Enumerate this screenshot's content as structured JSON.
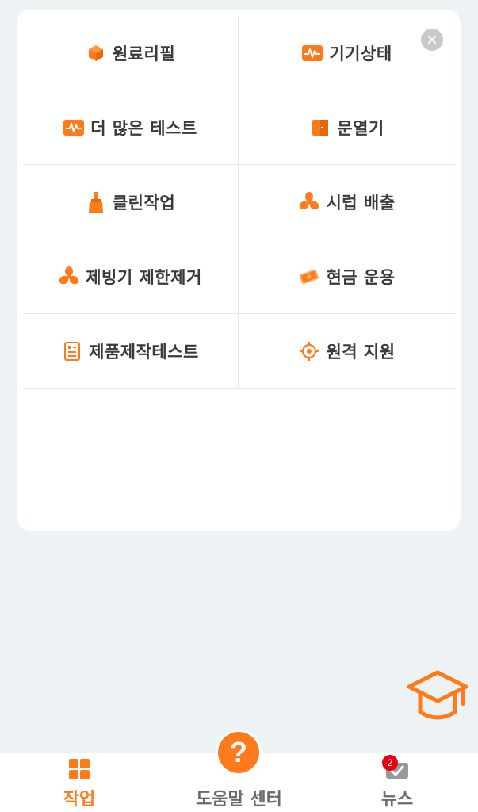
{
  "colors": {
    "accent": "#ff7a1a",
    "background": "#edf2f5",
    "text": "#3a3a3a",
    "badge": "#e60012"
  },
  "menu": {
    "items": [
      {
        "label": "원료리필",
        "icon": "box-icon"
      },
      {
        "label": "기기상태",
        "icon": "pulse-icon"
      },
      {
        "label": "더 많은 테스트",
        "icon": "pulse-icon"
      },
      {
        "label": "문열기",
        "icon": "door-icon"
      },
      {
        "label": "클린작업",
        "icon": "brush-icon"
      },
      {
        "label": "시럽 배출",
        "icon": "fan-icon"
      },
      {
        "label": "제빙기 제한제거",
        "icon": "fan-icon"
      },
      {
        "label": "현금 운용",
        "icon": "cash-icon"
      },
      {
        "label": "제품제작테스트",
        "icon": "document-icon"
      },
      {
        "label": "원격 지원",
        "icon": "target-icon"
      }
    ]
  },
  "nav": {
    "work": "작업",
    "help": "도움말 센터",
    "news": "뉴스",
    "news_badge": "2"
  }
}
